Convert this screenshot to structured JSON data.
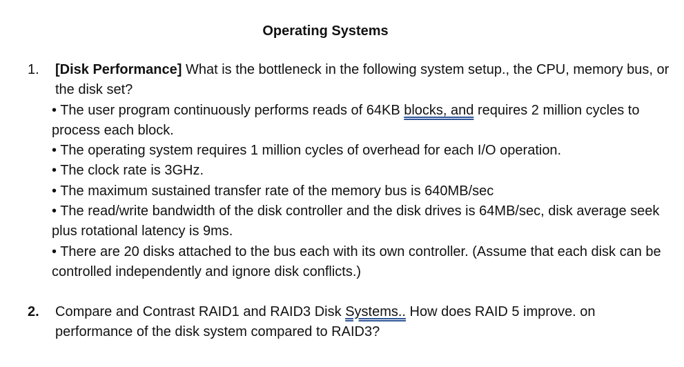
{
  "document": {
    "title": "Operating Systems",
    "questions": [
      {
        "number": "1.",
        "heading": "[Disk Performance]",
        "prompt": " What is the bottleneck in the following system setup., the CPU, memory bus, or the disk set?",
        "bullets": [
          {
            "pre": "• The user program continuously performs reads of 64KB ",
            "flagged": "blocks, and",
            "post": " requires 2 million cycles to process each block."
          },
          {
            "text": "• The operating system requires 1 million cycles of overhead for each I/O operation."
          },
          {
            "text": "• The clock rate is 3GHz."
          },
          {
            "text": "• The maximum sustained transfer rate of the memory bus is 640MB/sec"
          },
          {
            "text": "• The read/write bandwidth of the disk controller and the disk drives is 64MB/sec, disk average seek plus rotational latency is 9ms."
          },
          {
            "text": "• There are 20 disks attached to the bus each with its own controller. (Assume that each disk can be controlled independently and ignore disk conflicts.)"
          }
        ]
      },
      {
        "number": "2.",
        "pre": "Compare and Contrast RAID1 and RAID3 Disk ",
        "flagged": "Systems..",
        "post": " How does RAID 5 improve. on performance of the disk system compared to RAID3?"
      }
    ]
  }
}
